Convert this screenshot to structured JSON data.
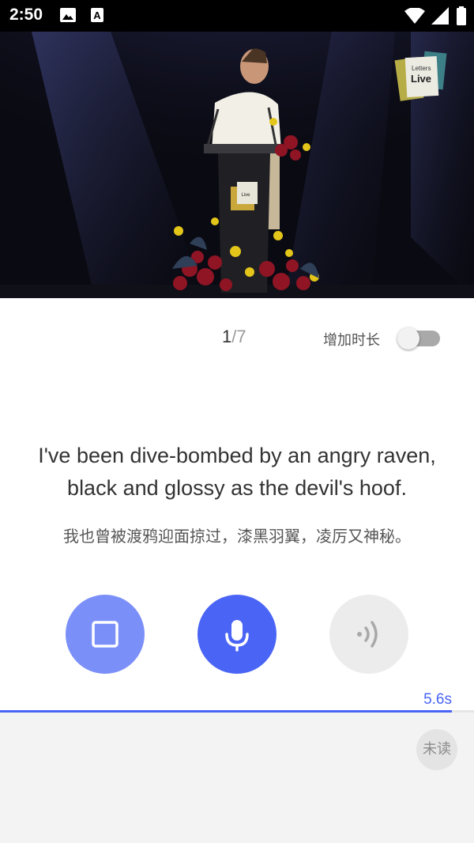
{
  "status_bar": {
    "time": "2:50",
    "icons": [
      "image-icon",
      "a-letter-icon",
      "wifi-icon",
      "signal-icon",
      "battery-icon"
    ]
  },
  "video": {
    "logo_text_top": "Letters",
    "logo_text_bottom": "Live"
  },
  "progress_counter": {
    "current": "1",
    "separator": "/",
    "total": "7"
  },
  "extend_duration": {
    "label": "增加时长",
    "enabled": false
  },
  "sentence": {
    "english_line1": "I've been dive-bombed by an angry raven,",
    "english_line2": "black and glossy as the devil's hoof.",
    "chinese": "我也曾被渡鸦迎面掠过，漆黑羽翼，凌厉又神秘。"
  },
  "actions": {
    "stop_icon": "stop-square-icon",
    "record_icon": "microphone-icon",
    "playback_icon": "sound-wave-icon"
  },
  "recording": {
    "elapsed": "5.6s",
    "progress_fraction": 0.953
  },
  "status_badge": "未读",
  "colors": {
    "primary": "#4a65f6",
    "primary_light": "#7b8ff8",
    "disabled": "#ececec"
  }
}
